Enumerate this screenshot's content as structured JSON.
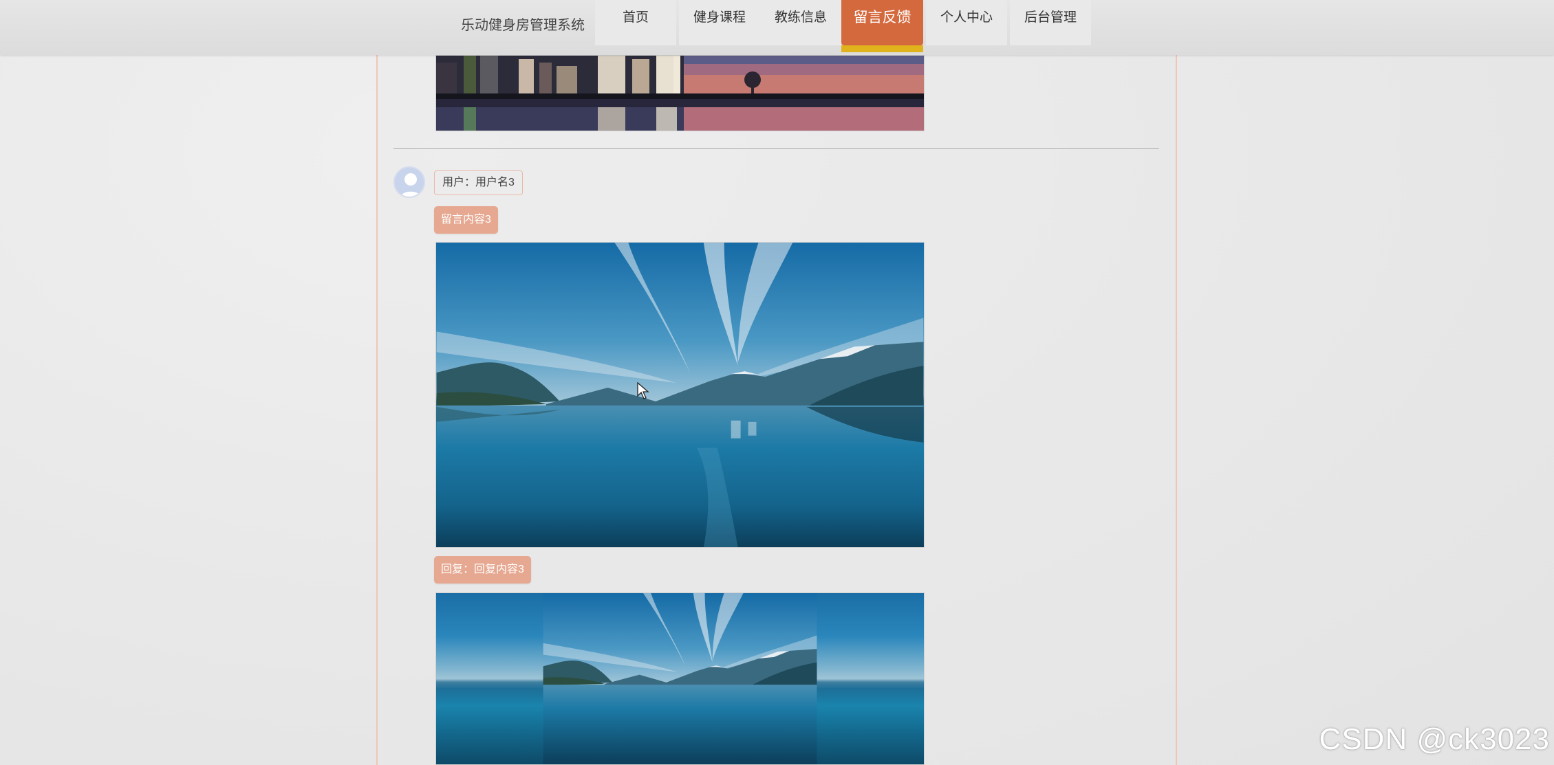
{
  "nav": {
    "brand": "乐动健身房管理系统",
    "items": [
      {
        "label": "首页"
      },
      {
        "label": "健身课程"
      },
      {
        "label": "教练信息"
      },
      {
        "label": "留言反馈",
        "active": true
      },
      {
        "label": "个人中心"
      },
      {
        "label": "后台管理"
      }
    ],
    "active_color": "#d4693e",
    "active_underline_color": "#e0b21c"
  },
  "message": {
    "user_label": "用户：用户名3",
    "content_label": "留言内容3",
    "reply_label": "回复：回复内容3",
    "pill_color": "#e6a891"
  },
  "images": {
    "top": "city-skyline-image",
    "content": "lake-mountain-image",
    "reply": "lake-mountain-image"
  },
  "watermark": "CSDN @ck3023"
}
